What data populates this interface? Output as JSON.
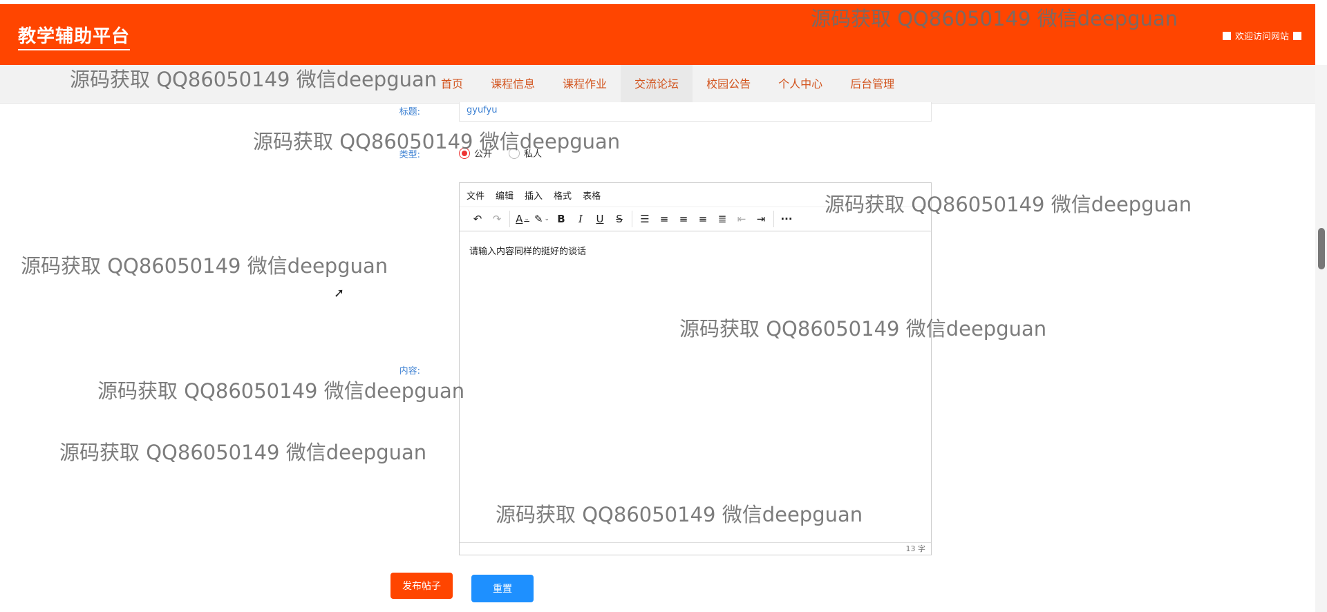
{
  "header": {
    "site_title": "教学辅助平台",
    "welcome_text": "欢迎访问网站"
  },
  "nav": {
    "items": [
      {
        "label": "首页"
      },
      {
        "label": "课程信息"
      },
      {
        "label": "课程作业"
      },
      {
        "label": "交流论坛"
      },
      {
        "label": "校园公告"
      },
      {
        "label": "个人中心"
      },
      {
        "label": "后台管理"
      }
    ],
    "active_index": 3
  },
  "form": {
    "title_label": "标题:",
    "title_value": "gyufyu",
    "type_label": "类型:",
    "type_options": [
      {
        "label": "公开",
        "checked": true
      },
      {
        "label": "私人",
        "checked": false
      }
    ],
    "content_label": "内容:"
  },
  "editor": {
    "menu": [
      "文件",
      "编辑",
      "插入",
      "格式",
      "表格"
    ],
    "content": "请输入内容同样的挺好的谈话",
    "word_count": "13 字"
  },
  "buttons": {
    "publish": "发布帖子",
    "reset": "重置"
  },
  "watermark": "源码获取 QQ86050149 微信deepguan"
}
